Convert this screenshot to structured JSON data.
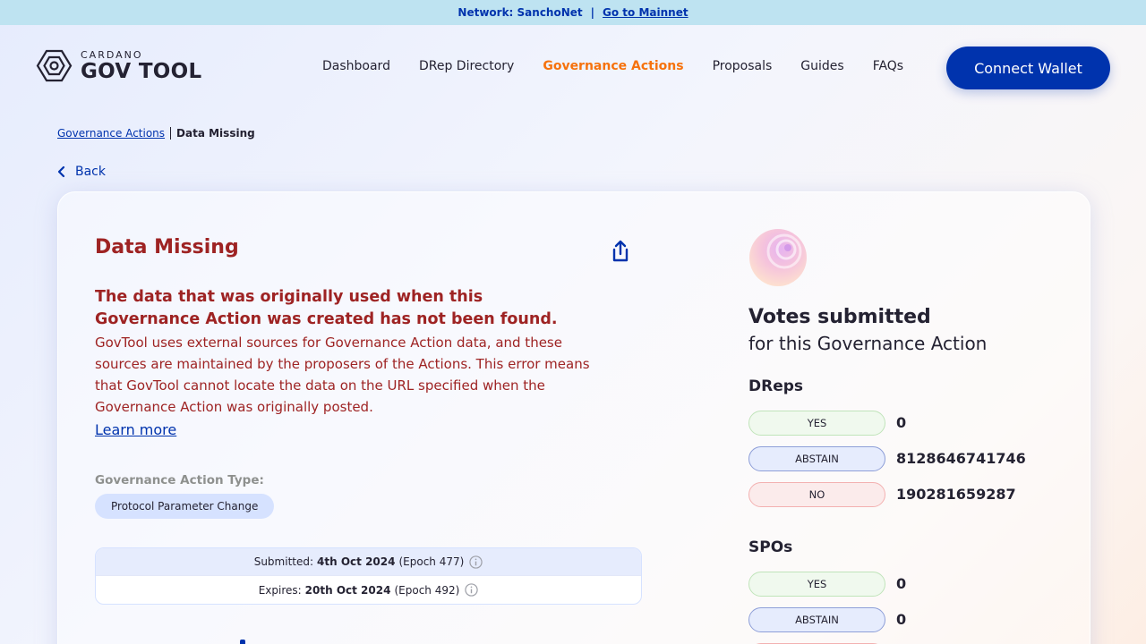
{
  "banner": {
    "network_text": "Network: SanchoNet",
    "separator": "|",
    "mainnet_link": "Go to Mainnet"
  },
  "logo": {
    "small": "CARDANO",
    "big": "GOV TOOL"
  },
  "nav": {
    "items": [
      {
        "label": "Dashboard"
      },
      {
        "label": "DRep Directory"
      },
      {
        "label": "Governance Actions",
        "active": true
      },
      {
        "label": "Proposals"
      },
      {
        "label": "Guides"
      },
      {
        "label": "FAQs"
      }
    ],
    "connect_wallet": "Connect Wallet"
  },
  "breadcrumb": {
    "parent": "Governance Actions",
    "current": "Data Missing"
  },
  "back_label": "Back",
  "action": {
    "title": "Data Missing",
    "error_heading": "The data that was originally used when this Governance Action was created has not been found.",
    "error_body": "GovTool uses external sources for Governance Action data, and these sources are maintained by the proposers of the Actions. This error means that GovTool cannot locate the data on the URL specified when the Governance Action was originally posted.",
    "learn_more": "Learn more",
    "type_label": "Governance Action Type:",
    "type_value": "Protocol Parameter Change",
    "submitted": {
      "label": "Submitted:",
      "date": "4th Oct 2024",
      "epoch": "(Epoch 477)"
    },
    "expires": {
      "label": "Expires:",
      "date": "20th Oct 2024",
      "epoch": "(Epoch 492)"
    }
  },
  "votes": {
    "title": "Votes submitted",
    "subtitle": "for this Governance Action",
    "dreps": {
      "title": "DReps",
      "yes_label": "YES",
      "yes_value": "0",
      "abstain_label": "ABSTAIN",
      "abstain_value": "8128646741746",
      "no_label": "NO",
      "no_value": "190281659287"
    },
    "spos": {
      "title": "SPOs",
      "yes_label": "YES",
      "yes_value": "0",
      "abstain_label": "ABSTAIN",
      "abstain_value": "0"
    }
  },
  "colors": {
    "primary": "#0033ad",
    "accent": "#f6720d",
    "error": "#9e2323",
    "banner": "#bee3f1"
  },
  "icons": {
    "logo": "hexagon-logo-icon",
    "share": "share-icon",
    "back": "chevron-left-icon",
    "info": "info-icon"
  }
}
